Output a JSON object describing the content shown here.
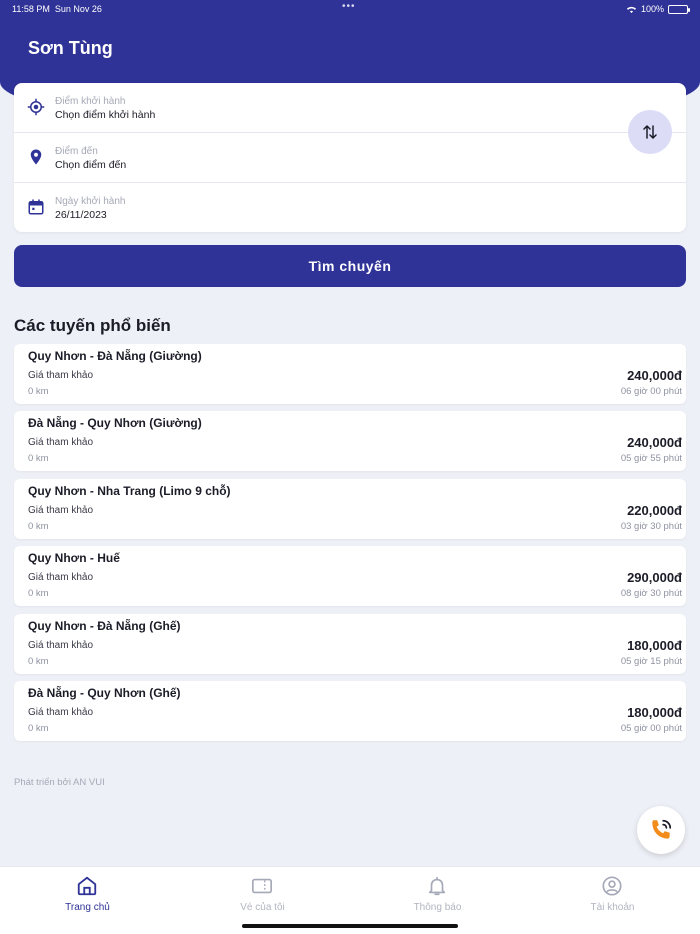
{
  "status_bar": {
    "time": "11:58 PM",
    "date": "Sun Nov 26",
    "battery": "100%",
    "battery_level": 1.0
  },
  "header": {
    "user_name": "Sơn Tùng"
  },
  "search": {
    "departure_label": "Điểm khởi hành",
    "departure_value": "Chọn điểm khởi hành",
    "destination_label": "Điểm đến",
    "destination_value": "Chọn điểm đến",
    "date_label": "Ngày khởi hành",
    "date_value": "26/11/2023",
    "search_button": "Tìm chuyến"
  },
  "popular": {
    "title": "Các tuyến phổ biến",
    "routes": [
      {
        "name": "Quy Nhơn - Đà Nẵng (Giường)",
        "price_label": "Giá tham khảo",
        "distance": "0 km",
        "price": "240,000đ",
        "duration": "06 giờ 00 phút"
      },
      {
        "name": "Đà Nẵng - Quy Nhơn (Giường)",
        "price_label": "Giá tham khảo",
        "distance": "0 km",
        "price": "240,000đ",
        "duration": "05 giờ 55 phút"
      },
      {
        "name": "Quy Nhơn - Nha Trang (Limo 9 chỗ)",
        "price_label": "Giá tham khảo",
        "distance": "0 km",
        "price": "220,000đ",
        "duration": "03 giờ 30 phút"
      },
      {
        "name": "Quy Nhơn - Huế",
        "price_label": "Giá tham khảo",
        "distance": "0 km",
        "price": "290,000đ",
        "duration": "08 giờ 30 phút"
      },
      {
        "name": "Quy Nhơn - Đà Nẵng (Ghế)",
        "price_label": "Giá tham khảo",
        "distance": "0 km",
        "price": "180,000đ",
        "duration": "05 giờ 15 phút"
      },
      {
        "name": "Đà Nẵng - Quy Nhơn (Ghế)",
        "price_label": "Giá tham khảo",
        "distance": "0 km",
        "price": "180,000đ",
        "duration": "05 giờ 00 phút"
      }
    ]
  },
  "footer": {
    "credit": "Phát triển bởi AN VUI"
  },
  "nav": {
    "items": [
      {
        "label": "Trang chủ",
        "icon": "home-icon",
        "active": true
      },
      {
        "label": "Vé của tôi",
        "icon": "ticket-icon",
        "active": false
      },
      {
        "label": "Thông báo",
        "icon": "bell-icon",
        "active": false
      },
      {
        "label": "Tài khoản",
        "icon": "user-icon",
        "active": false
      }
    ]
  },
  "colors": {
    "primary": "#2f3397",
    "background": "#eef0f7",
    "accent_call": "#f28c1b"
  }
}
